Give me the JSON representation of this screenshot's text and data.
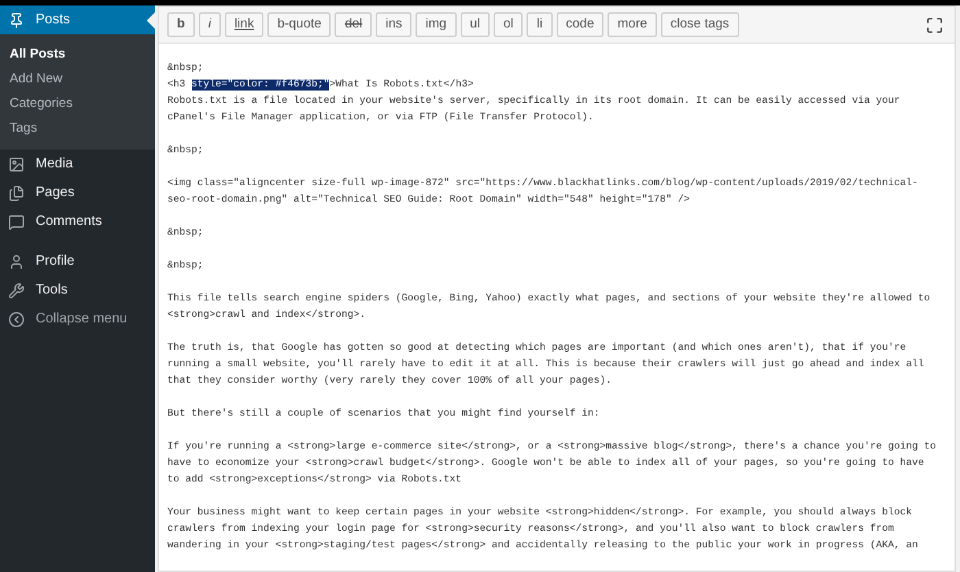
{
  "sidebar": {
    "items": [
      {
        "label": "Posts",
        "selected": true,
        "children": [
          {
            "label": "All Posts",
            "selected": true
          },
          {
            "label": "Add New",
            "selected": false
          },
          {
            "label": "Categories",
            "selected": false
          },
          {
            "label": "Tags",
            "selected": false
          }
        ]
      },
      {
        "label": "Media",
        "selected": false
      },
      {
        "label": "Pages",
        "selected": false
      },
      {
        "label": "Comments",
        "selected": false
      },
      {
        "label": "Profile",
        "selected": false
      },
      {
        "label": "Tools",
        "selected": false
      },
      {
        "label": "Collapse menu",
        "selected": false
      }
    ]
  },
  "toolbar": {
    "buttons": [
      {
        "label": "b"
      },
      {
        "label": "i"
      },
      {
        "label": "link"
      },
      {
        "label": "b-quote"
      },
      {
        "label": "del"
      },
      {
        "label": "ins"
      },
      {
        "label": "img"
      },
      {
        "label": "ul"
      },
      {
        "label": "ol"
      },
      {
        "label": "li"
      },
      {
        "label": "code"
      },
      {
        "label": "more"
      },
      {
        "label": "close tags"
      }
    ]
  },
  "editor": {
    "paragraphs": [
      {
        "lines": [
          [
            {
              "text": "&nbsp;",
              "selected": false
            }
          ],
          [
            {
              "text": "<h3 ",
              "selected": false
            },
            {
              "text": "style=\"color: #f4673b;\"",
              "selected": true
            },
            {
              "text": ">What Is Robots.txt</h3>",
              "selected": false
            }
          ],
          [
            {
              "text": "Robots.txt is a file located in your website's server, specifically in its root domain. It can be easily accessed via your",
              "selected": false
            }
          ],
          [
            {
              "text": "cPanel's File Manager application, or via FTP (File Transfer Protocol).",
              "selected": false
            }
          ]
        ]
      },
      {
        "lines": [
          [
            {
              "text": "&nbsp;",
              "selected": false
            }
          ]
        ]
      },
      {
        "lines": [
          [
            {
              "text": "<img class=\"aligncenter size-full wp-image-872\" src=\"https://www.blackhatlinks.com/blog/wp-content/uploads/2019/02/technical-",
              "selected": false
            }
          ],
          [
            {
              "text": "seo-root-domain.png\" alt=\"Technical SEO Guide: Root Domain\" width=\"548\" height=\"178\" />",
              "selected": false
            }
          ]
        ]
      },
      {
        "lines": [
          [
            {
              "text": "&nbsp;",
              "selected": false
            }
          ]
        ]
      },
      {
        "lines": [
          [
            {
              "text": "&nbsp;",
              "selected": false
            }
          ]
        ]
      },
      {
        "lines": [
          [
            {
              "text": "This file tells search engine spiders (Google, Bing, Yahoo) exactly what pages, and sections of your website they're allowed to",
              "selected": false
            }
          ],
          [
            {
              "text": "<strong>crawl and index</strong>.",
              "selected": false
            }
          ]
        ]
      },
      {
        "lines": [
          [
            {
              "text": "The truth is, that Google has gotten so good at detecting which pages are important (and which ones aren't), that if you're",
              "selected": false
            }
          ],
          [
            {
              "text": "running a small website, you'll rarely have to edit it at all. This is because their crawlers will just go ahead and index all",
              "selected": false
            }
          ],
          [
            {
              "text": "that they consider worthy (very rarely they cover 100% of all your pages).",
              "selected": false
            }
          ]
        ]
      },
      {
        "lines": [
          [
            {
              "text": "But there's still a couple of scenarios that you might find yourself in:",
              "selected": false
            }
          ]
        ]
      },
      {
        "lines": [
          [
            {
              "text": "If you're running a <strong>large e-commerce site</strong>, or a <strong>massive blog</strong>, there's a chance you're going to",
              "selected": false
            }
          ],
          [
            {
              "text": "have to economize your <strong>crawl budget</strong>. Google won't be able to index all of your pages, so you're going to have",
              "selected": false
            }
          ],
          [
            {
              "text": "to add <strong>exceptions</strong> via Robots.txt",
              "selected": false
            }
          ]
        ]
      },
      {
        "lines": [
          [
            {
              "text": "Your business might want to keep certain pages in your website <strong>hidden</strong>. For example, you should always block",
              "selected": false
            }
          ],
          [
            {
              "text": "crawlers from indexing your login page for <strong>security reasons</strong>, and you'll also want to block crawlers from",
              "selected": false
            }
          ],
          [
            {
              "text": "wandering in your <strong>staging/test pages</strong> and accidentally releasing to the public your work in progress (AKA, an",
              "selected": false
            }
          ]
        ]
      }
    ]
  }
}
